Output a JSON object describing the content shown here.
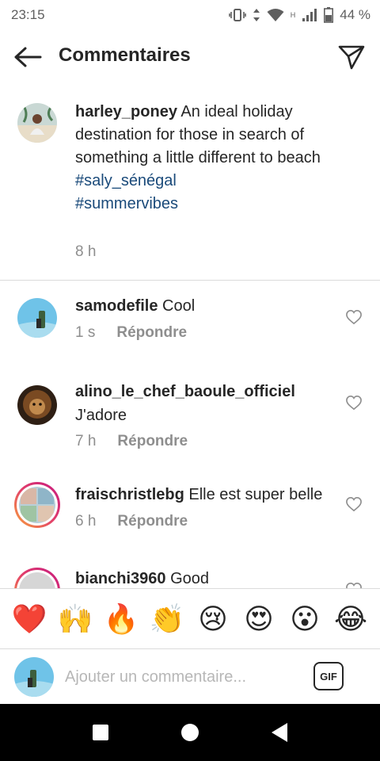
{
  "status_bar": {
    "time": "23:15",
    "network_type": "H",
    "battery": "44 %"
  },
  "header": {
    "title": "Commentaires",
    "back_icon": "arrow-left-icon",
    "share_icon": "paper-plane-icon"
  },
  "caption": {
    "username": "harley_poney",
    "text": "An ideal holiday destination for those in search of something a little different to beach",
    "hashtags": [
      "#saly_sénégal",
      "#summervibes"
    ],
    "time": "8 h"
  },
  "comments": [
    {
      "username": "samodefile",
      "text": "Cool",
      "time": "1 s",
      "reply_label": "Répondre"
    },
    {
      "username": "alino_le_chef_baoule_officiel",
      "text": "J'adore",
      "time": "7 h",
      "reply_label": "Répondre"
    },
    {
      "username": "fraischristlebg",
      "text": "Elle est super belle",
      "time": "6 h",
      "reply_label": "Répondre"
    },
    {
      "username": "bianchi3960",
      "text": "Good"
    }
  ],
  "emoji_bar": [
    "❤️",
    "🙌",
    "🔥",
    "👏",
    "😢",
    "😍",
    "😮",
    "😂"
  ],
  "comment_input": {
    "placeholder": "Ajouter un commentaire...",
    "gif_label": "GIF"
  },
  "colors": {
    "hashtag": "#1a4a7a",
    "muted": "#8e8e8e",
    "story_ring_start": "#f9a43a",
    "story_ring_end": "#c6197f"
  }
}
